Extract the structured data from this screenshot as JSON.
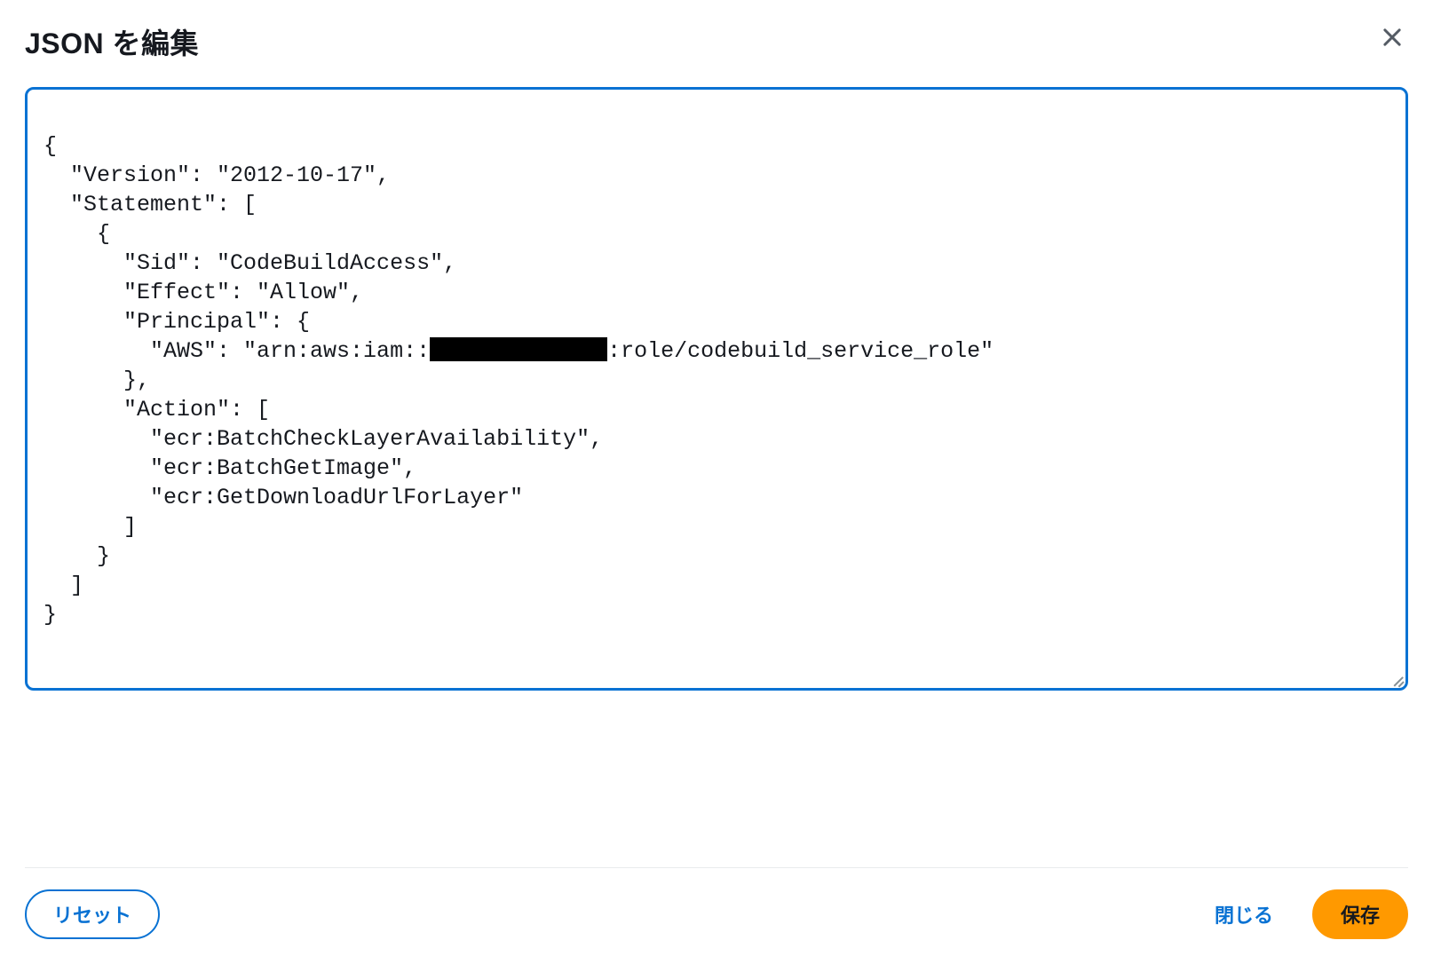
{
  "modal": {
    "title": "JSON を編集",
    "editor": {
      "line1": "{",
      "line2": "  \"Version\": \"2012-10-17\",",
      "line3": "  \"Statement\": [",
      "line4": "    {",
      "line5": "      \"Sid\": \"CodeBuildAccess\",",
      "line6": "      \"Effect\": \"Allow\",",
      "line7": "      \"Principal\": {",
      "line8_pre": "        \"AWS\": \"arn:aws:iam::",
      "line8_post": ":role/codebuild_service_role\"",
      "line9": "      },",
      "line10": "      \"Action\": [",
      "line11": "        \"ecr:BatchCheckLayerAvailability\",",
      "line12": "        \"ecr:BatchGetImage\",",
      "line13": "        \"ecr:GetDownloadUrlForLayer\"",
      "line14": "      ]",
      "line15": "    }",
      "line16": "  ]",
      "line17": "}"
    },
    "footer": {
      "reset_label": "リセット",
      "close_label": "閉じる",
      "save_label": "保存"
    }
  }
}
